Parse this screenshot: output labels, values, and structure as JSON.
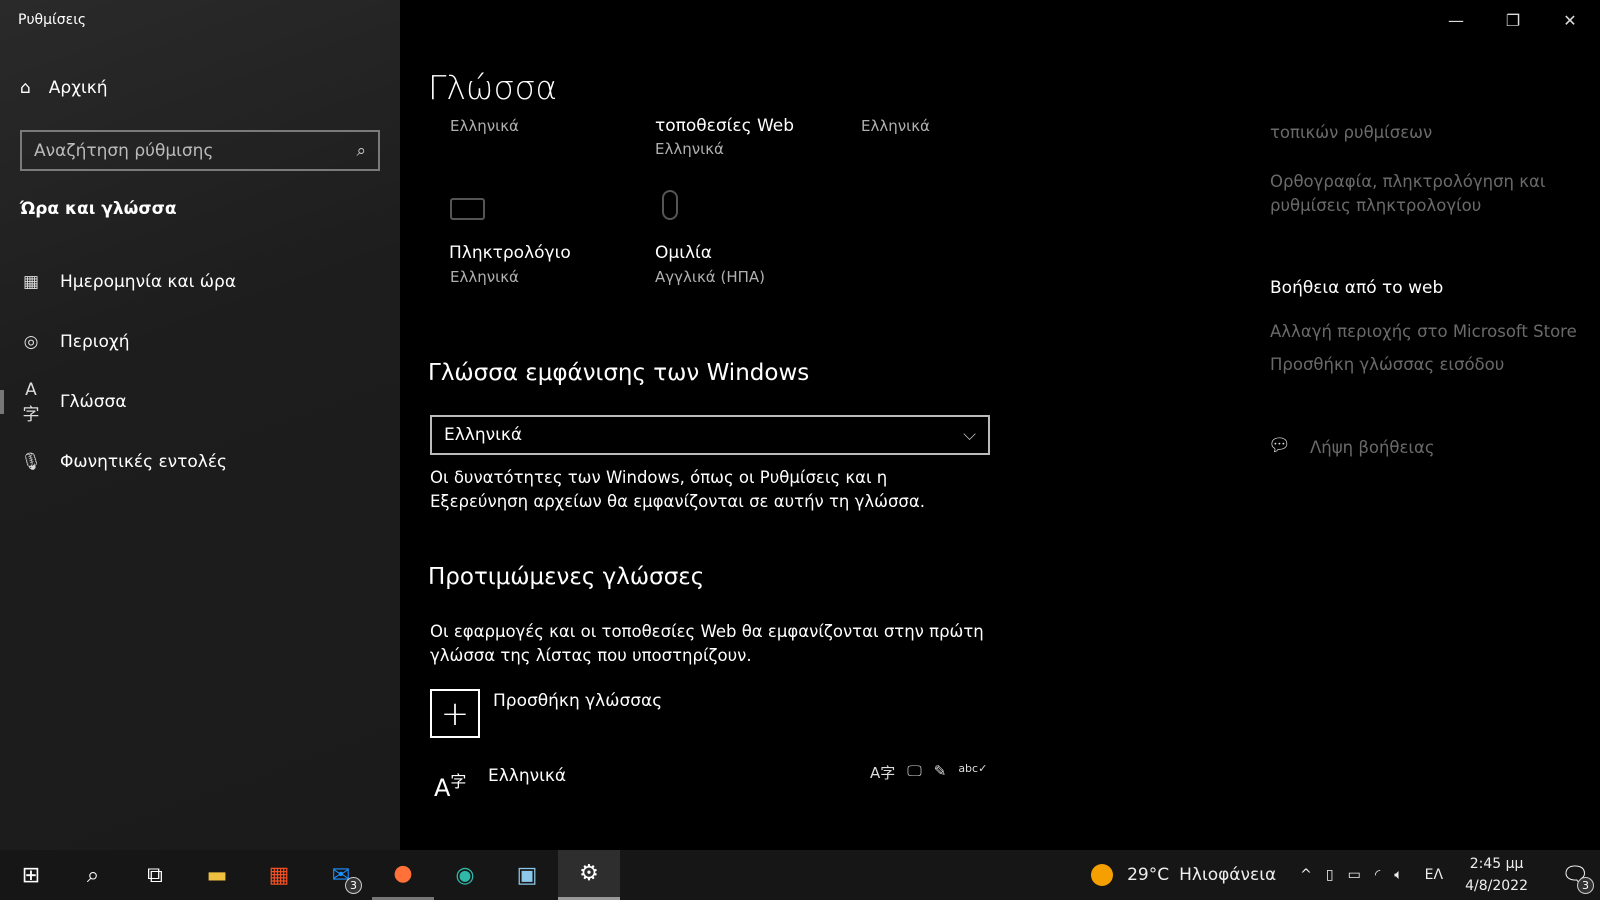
{
  "window": {
    "title": "Ρυθμίσεις"
  },
  "sidebar": {
    "home": "Αρχική",
    "search_placeholder": "Αναζήτηση ρύθμισης",
    "category": "Ώρα και γλώσσα",
    "items": [
      {
        "label": "Ημερομηνία και ώρα",
        "icon": "calendar-clock-icon"
      },
      {
        "label": "Περιοχή",
        "icon": "globe-icon"
      },
      {
        "label": "Γλώσσα",
        "icon": "language-icon",
        "selected": true
      },
      {
        "label": "Φωνητικές εντολές",
        "icon": "microphone-icon"
      }
    ]
  },
  "main": {
    "title": "Γλώσσα",
    "tiles": {
      "t1_value": "Ελληνικά",
      "t2_label": "τοποθεσίες Web",
      "t2_value": "Ελληνικά",
      "t3_value": "Ελληνικά",
      "keyboard_label": "Πληκτρολόγιο",
      "keyboard_value": "Ελληνικά",
      "speech_label": "Ομιλία",
      "speech_value": "Αγγλικά (ΗΠΑ)"
    },
    "display_lang": {
      "heading": "Γλώσσα εμφάνισης των Windows",
      "selected": "Ελληνικά",
      "description": "Οι δυνατότητες των Windows, όπως οι Ρυθμίσεις και η Εξερεύνηση αρχείων θα εμφανίζονται σε αυτήν τη γλώσσα."
    },
    "preferred": {
      "heading": "Προτιμώμενες γλώσσες",
      "description": "Οι εφαρμογές και οι τοποθεσίες Web θα εμφανίζονται στην πρώτη γλώσσα της λίστας που υποστηρίζουν.",
      "add_label": "Προσθήκη γλώσσας",
      "languages": [
        {
          "name": "Ελληνικά",
          "features": [
            "language-pack-icon",
            "speech-icon",
            "handwriting-icon",
            "spelling-icon"
          ]
        }
      ]
    }
  },
  "right": {
    "link_partial": "τοπικών ρυθμίσεων",
    "link_spelling": "Ορθογραφία, πληκτρολόγηση και ρυθμίσεις πληκτρολογίου",
    "web_help_heading": "Βοήθεια από το web",
    "web_links": [
      "Αλλαγή περιοχής στο Microsoft Store",
      "Προσθήκη γλώσσας εισόδου"
    ],
    "get_help": "Λήψη βοήθειας"
  },
  "taskbar": {
    "mail_badge": "3",
    "weather_temp": "29°C",
    "weather_text": "Ηλιοφάνεια",
    "ime": "ΕΛ",
    "time": "2:45 μμ",
    "date": "4/8/2022",
    "notif_badge": "3"
  }
}
